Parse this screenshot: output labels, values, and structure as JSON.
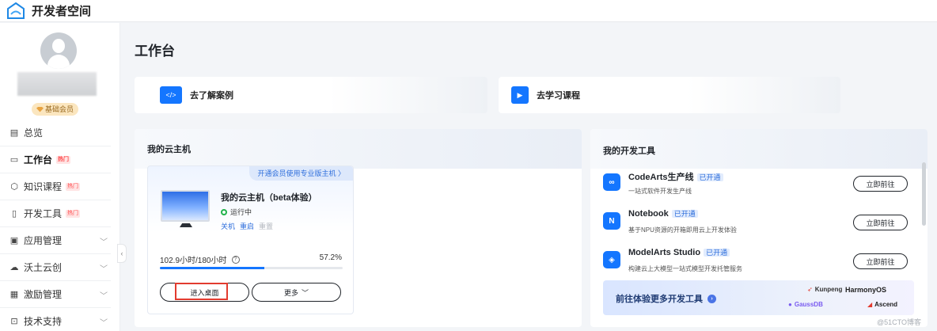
{
  "app": {
    "title": "开发者空间"
  },
  "sidebar": {
    "member_badge": "基础会员",
    "items": [
      {
        "label": "总览",
        "icon": "overview-icon",
        "hot": "",
        "chevron": false
      },
      {
        "label": "工作台",
        "icon": "workbench-icon",
        "hot": "热门",
        "chevron": false,
        "active": true
      },
      {
        "label": "知识课程",
        "icon": "course-icon",
        "hot": "热门",
        "chevron": false
      },
      {
        "label": "开发工具",
        "icon": "tools-icon",
        "hot": "热门",
        "chevron": false
      },
      {
        "label": "应用管理",
        "icon": "app-manage-icon",
        "hot": "",
        "chevron": true
      },
      {
        "label": "沃土云创",
        "icon": "cloud-create-icon",
        "hot": "",
        "chevron": true
      },
      {
        "label": "激励管理",
        "icon": "incentive-icon",
        "hot": "",
        "chevron": true
      },
      {
        "label": "技术支持",
        "icon": "support-icon",
        "hot": "",
        "chevron": true
      }
    ]
  },
  "main": {
    "title": "工作台",
    "quick_links": [
      {
        "label": "去了解案例",
        "icon": "code-case-icon"
      },
      {
        "label": "去学习课程",
        "icon": "video-course-icon"
      }
    ],
    "cloud_host": {
      "title": "我的云主机",
      "tag": "开通会员使用专业版主机 〉",
      "name": "我的云主机（beta体验）",
      "status": "运行中",
      "actions": [
        "关机",
        "重启",
        "重置"
      ],
      "hours": "102.9小时/180小时",
      "percent_text": "57.2%",
      "percent": 0.572,
      "enter_button": "进入桌面",
      "more_button": "更多"
    },
    "dev_tools": {
      "title": "我的开发工具",
      "go_label": "立即前往",
      "badge": "已开通",
      "items": [
        {
          "name": "CodeArts生产线",
          "desc": "一站式软件开发生产线",
          "icon": "codearts-icon"
        },
        {
          "name": "Notebook",
          "desc": "基于NPU资源的开箱即用云上开发体验",
          "icon": "notebook-icon"
        },
        {
          "name": "ModelArts Studio",
          "desc": "构建云上大模型一站式模型开发托管服务",
          "icon": "modelarts-icon"
        }
      ],
      "more_label": "前往体验更多开发工具",
      "brands": [
        "Kunpeng",
        "HarmonyOS",
        "GaussDB",
        "Ascend"
      ]
    }
  },
  "watermark": "@51CTO博客",
  "colors": {
    "accent": "#1476ff",
    "highlight": "#e23b2f",
    "running": "#22b34b"
  }
}
